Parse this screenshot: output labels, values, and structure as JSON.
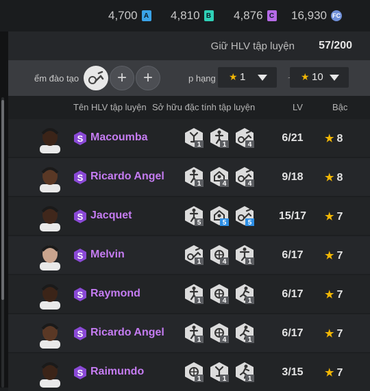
{
  "currencies": [
    {
      "value": "4,700",
      "badge": "A",
      "color": "#3aa3e8"
    },
    {
      "value": "4,810",
      "badge": "B",
      "color": "#2fd1b7"
    },
    {
      "value": "4,876",
      "badge": "C",
      "color": "#b56ae6"
    },
    {
      "value": "16,930",
      "badge": "FC",
      "color": "#6f8fd8"
    }
  ],
  "header": {
    "label": "Giữ HLV tập luyện",
    "count": "57/200"
  },
  "filter": {
    "label_left": "ểm đào tạo",
    "label_right": "p hạng",
    "min_grade": "1",
    "max_grade": "10",
    "separator": "~"
  },
  "columns": {
    "name": "Tên HLV tập luyện",
    "traits": "Sở hữu đặc tính tập luyện",
    "lv": "LV",
    "grade": "Bậc"
  },
  "rows": [
    {
      "name": "Macoumba",
      "traits": [
        {
          "icon": "pass-icon",
          "level": "1",
          "highlight": false
        },
        {
          "icon": "shot-icon",
          "level": "1",
          "highlight": false
        },
        {
          "icon": "kick-icon",
          "level": "4",
          "highlight": false
        }
      ],
      "lv": "6/21",
      "grade": "8",
      "skin": "#3b2418"
    },
    {
      "name": "Ricardo Angel",
      "traits": [
        {
          "icon": "shot-icon",
          "level": "1",
          "highlight": false
        },
        {
          "icon": "defense-icon",
          "level": "4",
          "highlight": false
        },
        {
          "icon": "kick-icon",
          "level": "4",
          "highlight": false
        }
      ],
      "lv": "9/18",
      "grade": "8",
      "skin": "#5a3825"
    },
    {
      "name": "Jacquet",
      "traits": [
        {
          "icon": "shot-icon",
          "level": "5",
          "highlight": false
        },
        {
          "icon": "defense-icon",
          "level": "5",
          "highlight": true
        },
        {
          "icon": "kick-icon",
          "level": "5",
          "highlight": true
        }
      ],
      "lv": "15/17",
      "grade": "7",
      "skin": "#40271b"
    },
    {
      "name": "Melvin",
      "traits": [
        {
          "icon": "kick-icon",
          "level": "1",
          "highlight": false
        },
        {
          "icon": "ball-icon",
          "level": "4",
          "highlight": false
        },
        {
          "icon": "goalkeeper-icon",
          "level": "1",
          "highlight": false
        }
      ],
      "lv": "6/17",
      "grade": "7",
      "skin": "#c9a48e"
    },
    {
      "name": "Raymond",
      "traits": [
        {
          "icon": "shot-icon",
          "level": "1",
          "highlight": false
        },
        {
          "icon": "ball-icon",
          "level": "4",
          "highlight": false
        },
        {
          "icon": "runner-icon",
          "level": "1",
          "highlight": false
        }
      ],
      "lv": "6/17",
      "grade": "7",
      "skin": "#3b2418"
    },
    {
      "name": "Ricardo Angel",
      "traits": [
        {
          "icon": "shot-icon",
          "level": "1",
          "highlight": false
        },
        {
          "icon": "ball-icon",
          "level": "4",
          "highlight": false
        },
        {
          "icon": "runner-icon",
          "level": "1",
          "highlight": false
        }
      ],
      "lv": "6/17",
      "grade": "7",
      "skin": "#5a3825"
    },
    {
      "name": "Raimundo",
      "traits": [
        {
          "icon": "ball-icon",
          "level": "1",
          "highlight": false
        },
        {
          "icon": "pass-icon",
          "level": "1",
          "highlight": false
        },
        {
          "icon": "runner-icon",
          "level": "1",
          "highlight": false
        }
      ],
      "lv": "3/15",
      "grade": "7",
      "skin": "#3b2418"
    }
  ]
}
